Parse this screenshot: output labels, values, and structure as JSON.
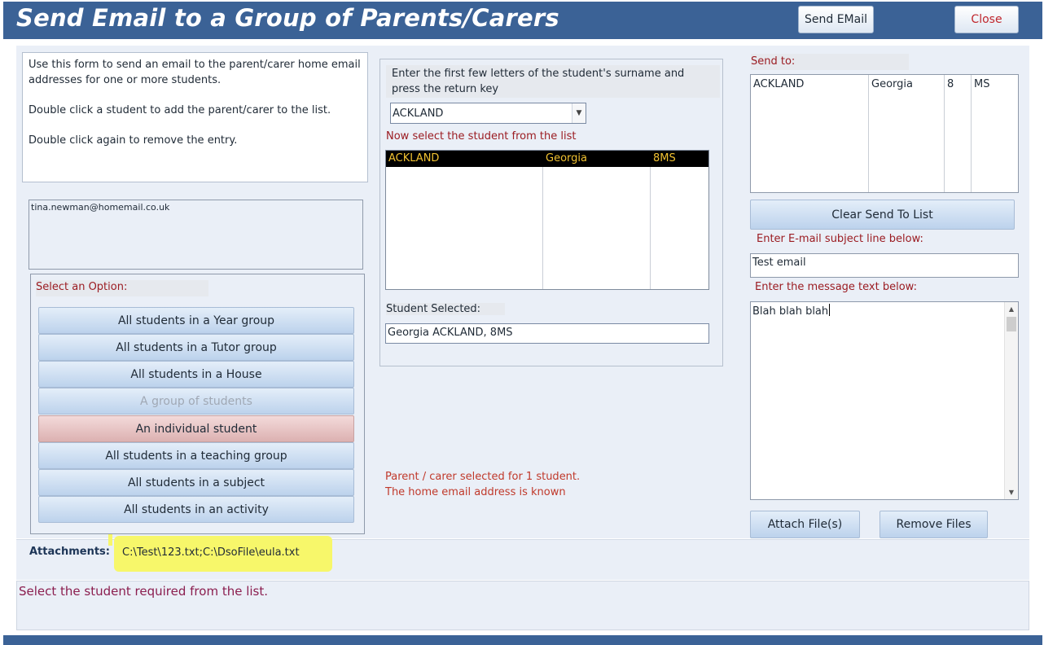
{
  "header": {
    "title": "Send Email to a Group of Parents/Carers",
    "send_email_label": "Send EMail",
    "close_label": "Close"
  },
  "instructions": [
    "Use this form to send an email to the parent/carer home email addresses for one or more students.",
    "Double click a student to add the parent/carer to the list.",
    "Double click again to remove the entry."
  ],
  "email_list": [
    "tina.newman@homemail.co.uk"
  ],
  "options": {
    "label": "Select an Option:",
    "items": [
      {
        "label": "All students in a Year group",
        "state": "normal"
      },
      {
        "label": "All students in a Tutor group",
        "state": "normal"
      },
      {
        "label": "All students in a House",
        "state": "normal"
      },
      {
        "label": "A group of students",
        "state": "disabled"
      },
      {
        "label": "An individual student",
        "state": "selected"
      },
      {
        "label": "All students in a teaching group",
        "state": "normal"
      },
      {
        "label": "All students in a subject",
        "state": "normal"
      },
      {
        "label": "All students in an activity",
        "state": "normal"
      }
    ]
  },
  "search": {
    "prompt": "Enter the first few letters of the student's surname and press the return key",
    "value": "ACKLAND",
    "now_select": "Now select the student from the list"
  },
  "student_list": {
    "rows": [
      {
        "surname": "ACKLAND",
        "forename": "Georgia",
        "form": "8MS",
        "selected": true
      }
    ]
  },
  "student_selected": {
    "label": "Student Selected:",
    "value": "Georgia ACKLAND, 8MS"
  },
  "parent_message": [
    "Parent / carer selected for 1 student.",
    "The home email address is known"
  ],
  "send_to": {
    "label": "Send to:",
    "rows": [
      {
        "surname": "ACKLAND",
        "forename": "Georgia",
        "year": "8",
        "tutor": "MS"
      }
    ],
    "clear_label": "Clear Send To List"
  },
  "subject": {
    "label": "Enter E-mail subject line below:",
    "value": "Test email"
  },
  "message": {
    "label": "Enter the message text below:",
    "value": "Blah blah blah"
  },
  "buttons": {
    "attach_label": "Attach File(s)",
    "remove_label": "Remove Files"
  },
  "attachments": {
    "label": "Attachments:",
    "value": "C:\\Test\\123.txt;C:\\DsoFile\\eula.txt"
  },
  "status": "Select the student required from the list.",
  "colors": {
    "header_bg": "#3b6296",
    "label_red": "#9b1c22",
    "highlight": "#f7f76a",
    "selected_row_text": "#f1c232"
  },
  "icons": {
    "combo_dropdown": "chevron-down-icon",
    "scroll_up": "scroll-up-icon",
    "scroll_down": "scroll-down-icon"
  }
}
